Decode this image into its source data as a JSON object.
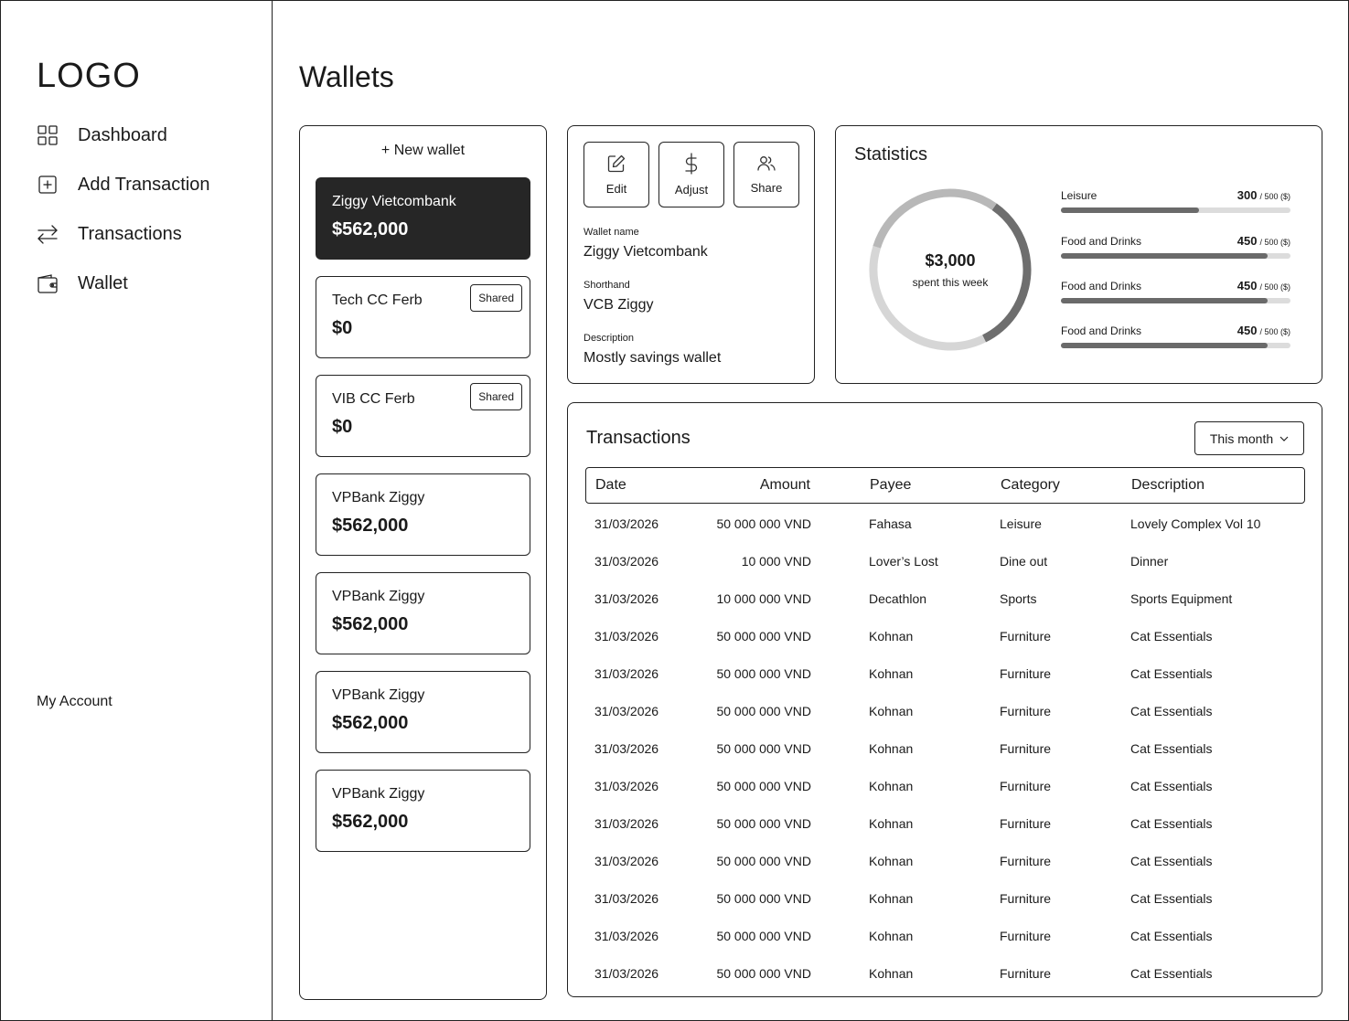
{
  "logo": "LOGO",
  "nav": [
    {
      "label": "Dashboard",
      "icon": "grid-icon"
    },
    {
      "label": "Add Transaction",
      "icon": "plus-square-icon"
    },
    {
      "label": "Transactions",
      "icon": "arrows-exchange-icon"
    },
    {
      "label": "Wallet",
      "icon": "wallet-icon"
    }
  ],
  "my_account": "My Account",
  "page_title": "Wallets",
  "wallet_list": {
    "new_wallet_label": "+ New wallet",
    "wallets": [
      {
        "name": "Ziggy Vietcombank",
        "amount": "$562,000",
        "shared": "",
        "active": true
      },
      {
        "name": "Tech CC Ferb",
        "amount": "$0",
        "shared": "Shared",
        "active": false
      },
      {
        "name": "VIB CC Ferb",
        "amount": "$0",
        "shared": "Shared",
        "active": false
      },
      {
        "name": "VPBank Ziggy",
        "amount": "$562,000",
        "shared": "",
        "active": false
      },
      {
        "name": "VPBank Ziggy",
        "amount": "$562,000",
        "shared": "",
        "active": false
      },
      {
        "name": "VPBank Ziggy",
        "amount": "$562,000",
        "shared": "",
        "active": false
      },
      {
        "name": "VPBank Ziggy",
        "amount": "$562,000",
        "shared": "",
        "active": false
      }
    ]
  },
  "detail": {
    "actions": [
      {
        "label": "Edit",
        "icon": "edit-icon"
      },
      {
        "label": "Adjust",
        "icon": "dollar-icon"
      },
      {
        "label": "Share",
        "icon": "users-icon"
      }
    ],
    "wallet_name_label": "Wallet name",
    "wallet_name": "Ziggy Vietcombank",
    "shorthand_label": "Shorthand",
    "shorthand": "VCB Ziggy",
    "description_label": "Description",
    "description": "Mostly savings wallet"
  },
  "statistics": {
    "title": "Statistics",
    "total": "$3,000",
    "total_sub": "spent this week",
    "donut_segments": [
      {
        "fraction": 0.33,
        "color": "#6e6e6e"
      },
      {
        "fraction": 0.37,
        "color": "#d6d6d6"
      },
      {
        "fraction": 0.3,
        "color": "#b8b8b8"
      }
    ],
    "categories": [
      {
        "name": "Leisure",
        "value": "300",
        "max": "/ 500 ($)",
        "ratio": 0.6
      },
      {
        "name": "Food and Drinks",
        "value": "450",
        "max": "/ 500 ($)",
        "ratio": 0.9
      },
      {
        "name": "Food and Drinks",
        "value": "450",
        "max": "/ 500 ($)",
        "ratio": 0.9
      },
      {
        "name": "Food and Drinks",
        "value": "450",
        "max": "/ 500 ($)",
        "ratio": 0.9
      }
    ]
  },
  "transactions": {
    "title": "Transactions",
    "filter": "This month",
    "columns": {
      "date": "Date",
      "amount": "Amount",
      "payee": "Payee",
      "category": "Category",
      "description": "Description"
    },
    "rows": [
      {
        "date": "31/03/2026",
        "amount": "50 000 000 VND",
        "payee": "Fahasa",
        "category": "Leisure",
        "description": "Lovely Complex Vol 10"
      },
      {
        "date": "31/03/2026",
        "amount": "10 000 VND",
        "payee": "Lover’s Lost",
        "category": "Dine out",
        "description": "Dinner"
      },
      {
        "date": "31/03/2026",
        "amount": "10 000 000 VND",
        "payee": "Decathlon",
        "category": "Sports",
        "description": "Sports Equipment"
      },
      {
        "date": "31/03/2026",
        "amount": "50 000 000 VND",
        "payee": "Kohnan",
        "category": "Furniture",
        "description": "Cat Essentials"
      },
      {
        "date": "31/03/2026",
        "amount": "50 000 000 VND",
        "payee": "Kohnan",
        "category": "Furniture",
        "description": "Cat Essentials"
      },
      {
        "date": "31/03/2026",
        "amount": "50 000 000 VND",
        "payee": "Kohnan",
        "category": "Furniture",
        "description": "Cat Essentials"
      },
      {
        "date": "31/03/2026",
        "amount": "50 000 000 VND",
        "payee": "Kohnan",
        "category": "Furniture",
        "description": "Cat Essentials"
      },
      {
        "date": "31/03/2026",
        "amount": "50 000 000 VND",
        "payee": "Kohnan",
        "category": "Furniture",
        "description": "Cat Essentials"
      },
      {
        "date": "31/03/2026",
        "amount": "50 000 000 VND",
        "payee": "Kohnan",
        "category": "Furniture",
        "description": "Cat Essentials"
      },
      {
        "date": "31/03/2026",
        "amount": "50 000 000 VND",
        "payee": "Kohnan",
        "category": "Furniture",
        "description": "Cat Essentials"
      },
      {
        "date": "31/03/2026",
        "amount": "50 000 000 VND",
        "payee": "Kohnan",
        "category": "Furniture",
        "description": "Cat Essentials"
      },
      {
        "date": "31/03/2026",
        "amount": "50 000 000 VND",
        "payee": "Kohnan",
        "category": "Furniture",
        "description": "Cat Essentials"
      },
      {
        "date": "31/03/2026",
        "amount": "50 000 000 VND",
        "payee": "Kohnan",
        "category": "Furniture",
        "description": "Cat Essentials"
      }
    ]
  }
}
